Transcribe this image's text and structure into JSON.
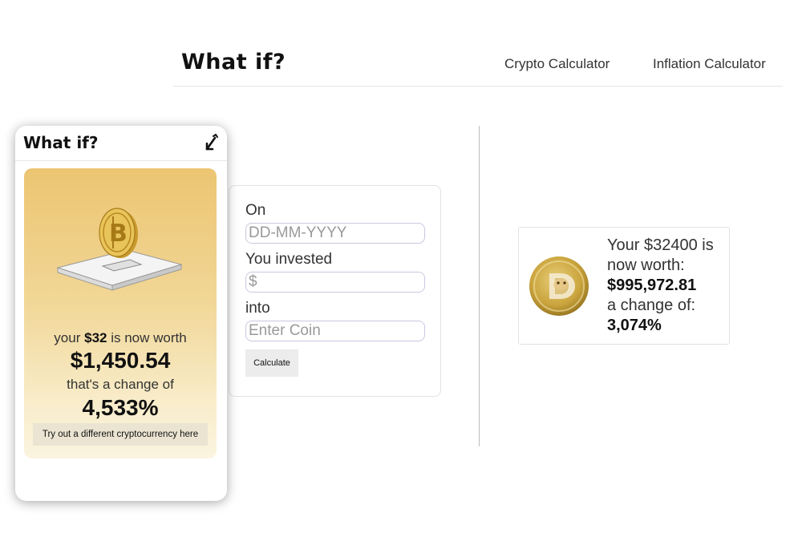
{
  "nav": {
    "brand": "What if?",
    "links": [
      {
        "label": "Crypto Calculator"
      },
      {
        "label": "Inflation Calculator"
      }
    ]
  },
  "form": {
    "date_label": "On",
    "date_placeholder": "DD-MM-YYYY",
    "amount_label": "You invested",
    "amount_placeholder": "$",
    "coin_label": "into",
    "coin_placeholder": "Enter Coin",
    "calculate_label": "Calculate"
  },
  "result": {
    "intro": "Your $32400 is now worth:",
    "worth": "$995,972.81",
    "change_label": "a change of:",
    "change": "3,074%",
    "coin_icon": "dogecoin-icon"
  },
  "phone": {
    "title": "What if?",
    "toggle_icon": "collapse-arrow-icon",
    "promo": {
      "worth_prefix": "your",
      "invested": "$32",
      "worth_suffix": "is now worth",
      "amount": "$1,450.54",
      "change_label": "that's a change of",
      "change": "4,533%",
      "button_label": "Try out a different cryptocurrency here",
      "illustration": "bitcoin-piggy-icon"
    }
  },
  "colors": {
    "promo_gradient_top": "#ecc572",
    "promo_gradient_bottom": "#fbf4df",
    "divider": "#bdbdbd"
  }
}
